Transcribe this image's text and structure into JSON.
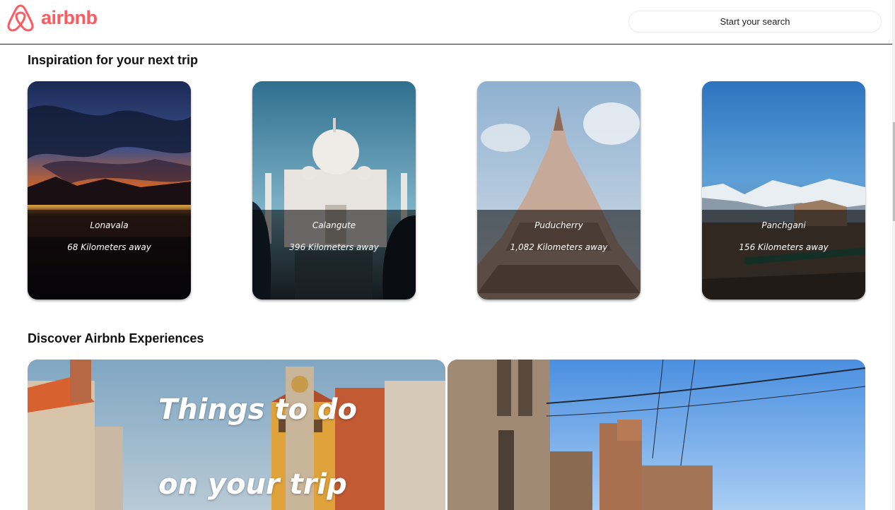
{
  "header": {
    "logo_text": "airbnb",
    "search_placeholder": "Start your search",
    "brand_color": "#ff5a5f"
  },
  "inspiration": {
    "title": "Inspiration for your next trip",
    "cards": [
      {
        "name": "Lonavala",
        "distance": "68 Kilometers away"
      },
      {
        "name": "Calangute",
        "distance": "396 Kilometers away"
      },
      {
        "name": "Puducherry",
        "distance": "1,082 Kilometers away"
      },
      {
        "name": "Panchgani",
        "distance": "156 Kilometers away"
      }
    ]
  },
  "experiences": {
    "title": "Discover Airbnb Experiences",
    "left_card": {
      "line1": "Things to do",
      "line2": "on your trip"
    }
  }
}
